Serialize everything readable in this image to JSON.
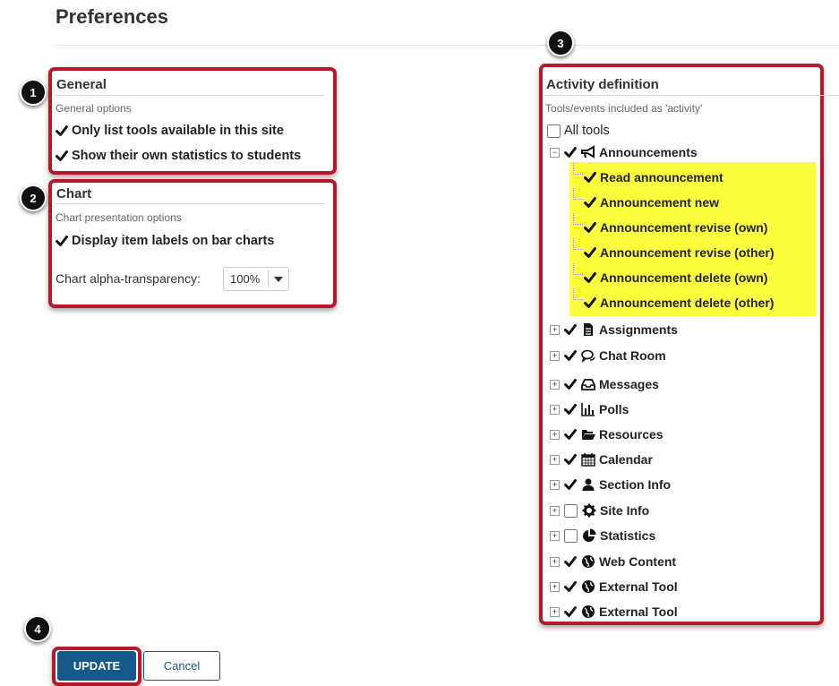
{
  "page": {
    "title": "Preferences"
  },
  "callouts": {
    "c1": "1",
    "c2": "2",
    "c3": "3",
    "c4": "4"
  },
  "general": {
    "heading": "General",
    "subtitle": "General options",
    "options": [
      {
        "label": "Only list tools available in this site",
        "checked": true
      },
      {
        "label": "Show their own statistics to students",
        "checked": true
      }
    ]
  },
  "chart": {
    "heading": "Chart",
    "subtitle": "Chart presentation options",
    "option": {
      "label": "Display item labels on bar charts",
      "checked": true
    },
    "alpha_label": "Chart alpha-transparency:",
    "alpha_value": "100%"
  },
  "activity": {
    "heading": "Activity definition",
    "subtitle": "Tools/events included as 'activity'",
    "all_tools": {
      "label": "All tools",
      "checked": false
    },
    "announcements": {
      "label": "Announcements",
      "checked": true,
      "expanded": true,
      "events": [
        {
          "label": "Read announcement",
          "checked": true
        },
        {
          "label": "Announcement new",
          "checked": true
        },
        {
          "label": "Announcement revise (own)",
          "checked": true
        },
        {
          "label": "Announcement revise (other)",
          "checked": true
        },
        {
          "label": "Announcement delete (own)",
          "checked": true
        },
        {
          "label": "Announcement delete (other)",
          "checked": true
        }
      ]
    },
    "tools": [
      {
        "label": "Assignments",
        "checked": true,
        "icon": "file-icon"
      },
      {
        "label": "Chat Room",
        "checked": true,
        "icon": "chat-icon"
      },
      {
        "label": "Messages",
        "checked": true,
        "icon": "inbox-icon"
      },
      {
        "label": "Polls",
        "checked": true,
        "icon": "bar-chart-icon"
      },
      {
        "label": "Resources",
        "checked": true,
        "icon": "folder-icon"
      },
      {
        "label": "Calendar",
        "checked": true,
        "icon": "calendar-icon"
      },
      {
        "label": "Section Info",
        "checked": true,
        "icon": "user-icon"
      },
      {
        "label": "Site Info",
        "checked": false,
        "icon": "gear-icon"
      },
      {
        "label": "Statistics",
        "checked": false,
        "icon": "pie-chart-icon"
      },
      {
        "label": "Web Content",
        "checked": true,
        "icon": "globe-icon"
      },
      {
        "label": "External Tool",
        "checked": true,
        "icon": "globe-icon"
      },
      {
        "label": "External Tool",
        "checked": true,
        "icon": "globe-icon"
      }
    ]
  },
  "buttons": {
    "update": "UPDATE",
    "cancel": "Cancel"
  },
  "colors": {
    "highlight": "#b31b2c",
    "primary": "#15598a",
    "event_highlight": "#fbff3e"
  }
}
